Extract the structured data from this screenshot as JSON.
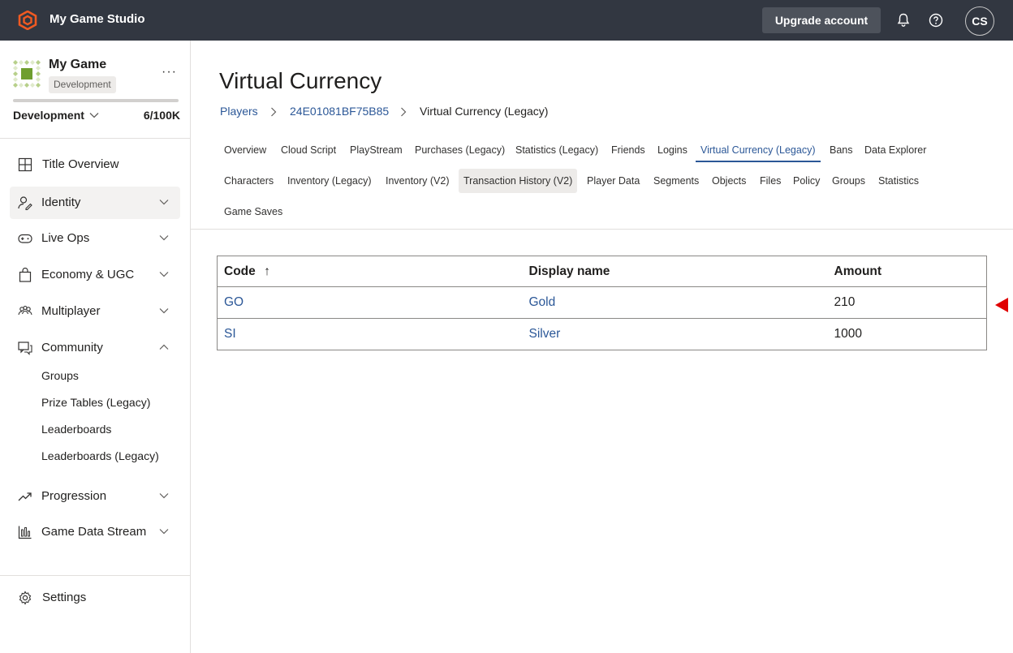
{
  "topbar": {
    "studio_name": "My Game Studio",
    "upgrade_label": "Upgrade account",
    "avatar_initials": "CS",
    "brand_color": "#f05a22"
  },
  "sidebar": {
    "game_name": "My Game",
    "game_badge": "Development",
    "environment": "Development",
    "usage": "6/100K",
    "items": [
      {
        "label": "Title Overview",
        "icon": "grid-icon"
      },
      {
        "label": "Identity",
        "icon": "identity-icon"
      },
      {
        "label": "Live Ops",
        "icon": "gamepad-icon"
      },
      {
        "label": "Economy & UGC",
        "icon": "shopping-bag-icon"
      },
      {
        "label": "Multiplayer",
        "icon": "people-icon"
      },
      {
        "label": "Community",
        "icon": "chat-icon"
      },
      {
        "label": "Progression",
        "icon": "trend-icon"
      },
      {
        "label": "Game Data Stream",
        "icon": "bar-chart-icon"
      }
    ],
    "community_sub": [
      "Groups",
      "Prize Tables (Legacy)",
      "Leaderboards",
      "Leaderboards (Legacy)"
    ],
    "settings_label": "Settings"
  },
  "main": {
    "title": "Virtual Currency",
    "breadcrumb": [
      "Players",
      "24E01081BF75B85",
      "Virtual Currency (Legacy)"
    ],
    "tabs_row1": [
      "Overview",
      "Cloud Script",
      "PlayStream",
      "Purchases (Legacy)",
      "Statistics (Legacy)",
      "Friends",
      "Logins",
      "Virtual Currency (Legacy)",
      "Bans",
      "Data Explorer"
    ],
    "tabs_row2": [
      "Characters",
      "Inventory (Legacy)",
      "Inventory (V2)",
      "Transaction History (V2)",
      "Player Data",
      "Segments",
      "Objects",
      "Files",
      "Policy",
      "Groups",
      "Statistics"
    ],
    "tabs_row3": [
      "Game Saves"
    ],
    "selected_tab": "Virtual Currency (Legacy)",
    "hovered_tab": "Transaction History (V2)",
    "table": {
      "headers": [
        "Code",
        "Display name",
        "Amount"
      ],
      "sort_indicator": "↑",
      "rows": [
        {
          "code": "GO",
          "name": "Gold",
          "amount": "210"
        },
        {
          "code": "SI",
          "name": "Silver",
          "amount": "1000"
        }
      ]
    },
    "link_color": "#2b5797",
    "marker_color": "#e00000"
  }
}
